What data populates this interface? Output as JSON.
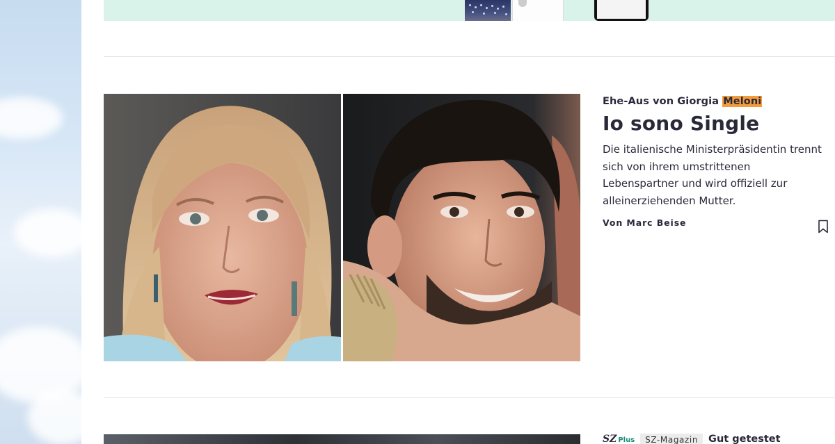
{
  "promo": {},
  "article": {
    "kicker_prefix": "Ehe-Aus von Giorgia ",
    "kicker_highlight": "Meloni",
    "headline": "Io sono Single",
    "summary": "Die italienische Ministerpräsidentin trennt sich von ihrem umstrittenen Lebenspartner und wird offiziell zur alleinerziehenden Mutter.",
    "byline": "Von Marc Beise",
    "highlight_color": "#f39c3d"
  },
  "next_article": {
    "brand": "SZ",
    "brand_plus": "Plus",
    "tag": "SZ-Magazin",
    "kicker": "Gut getestet"
  },
  "icons": {
    "bookmark": "bookmark-icon"
  }
}
